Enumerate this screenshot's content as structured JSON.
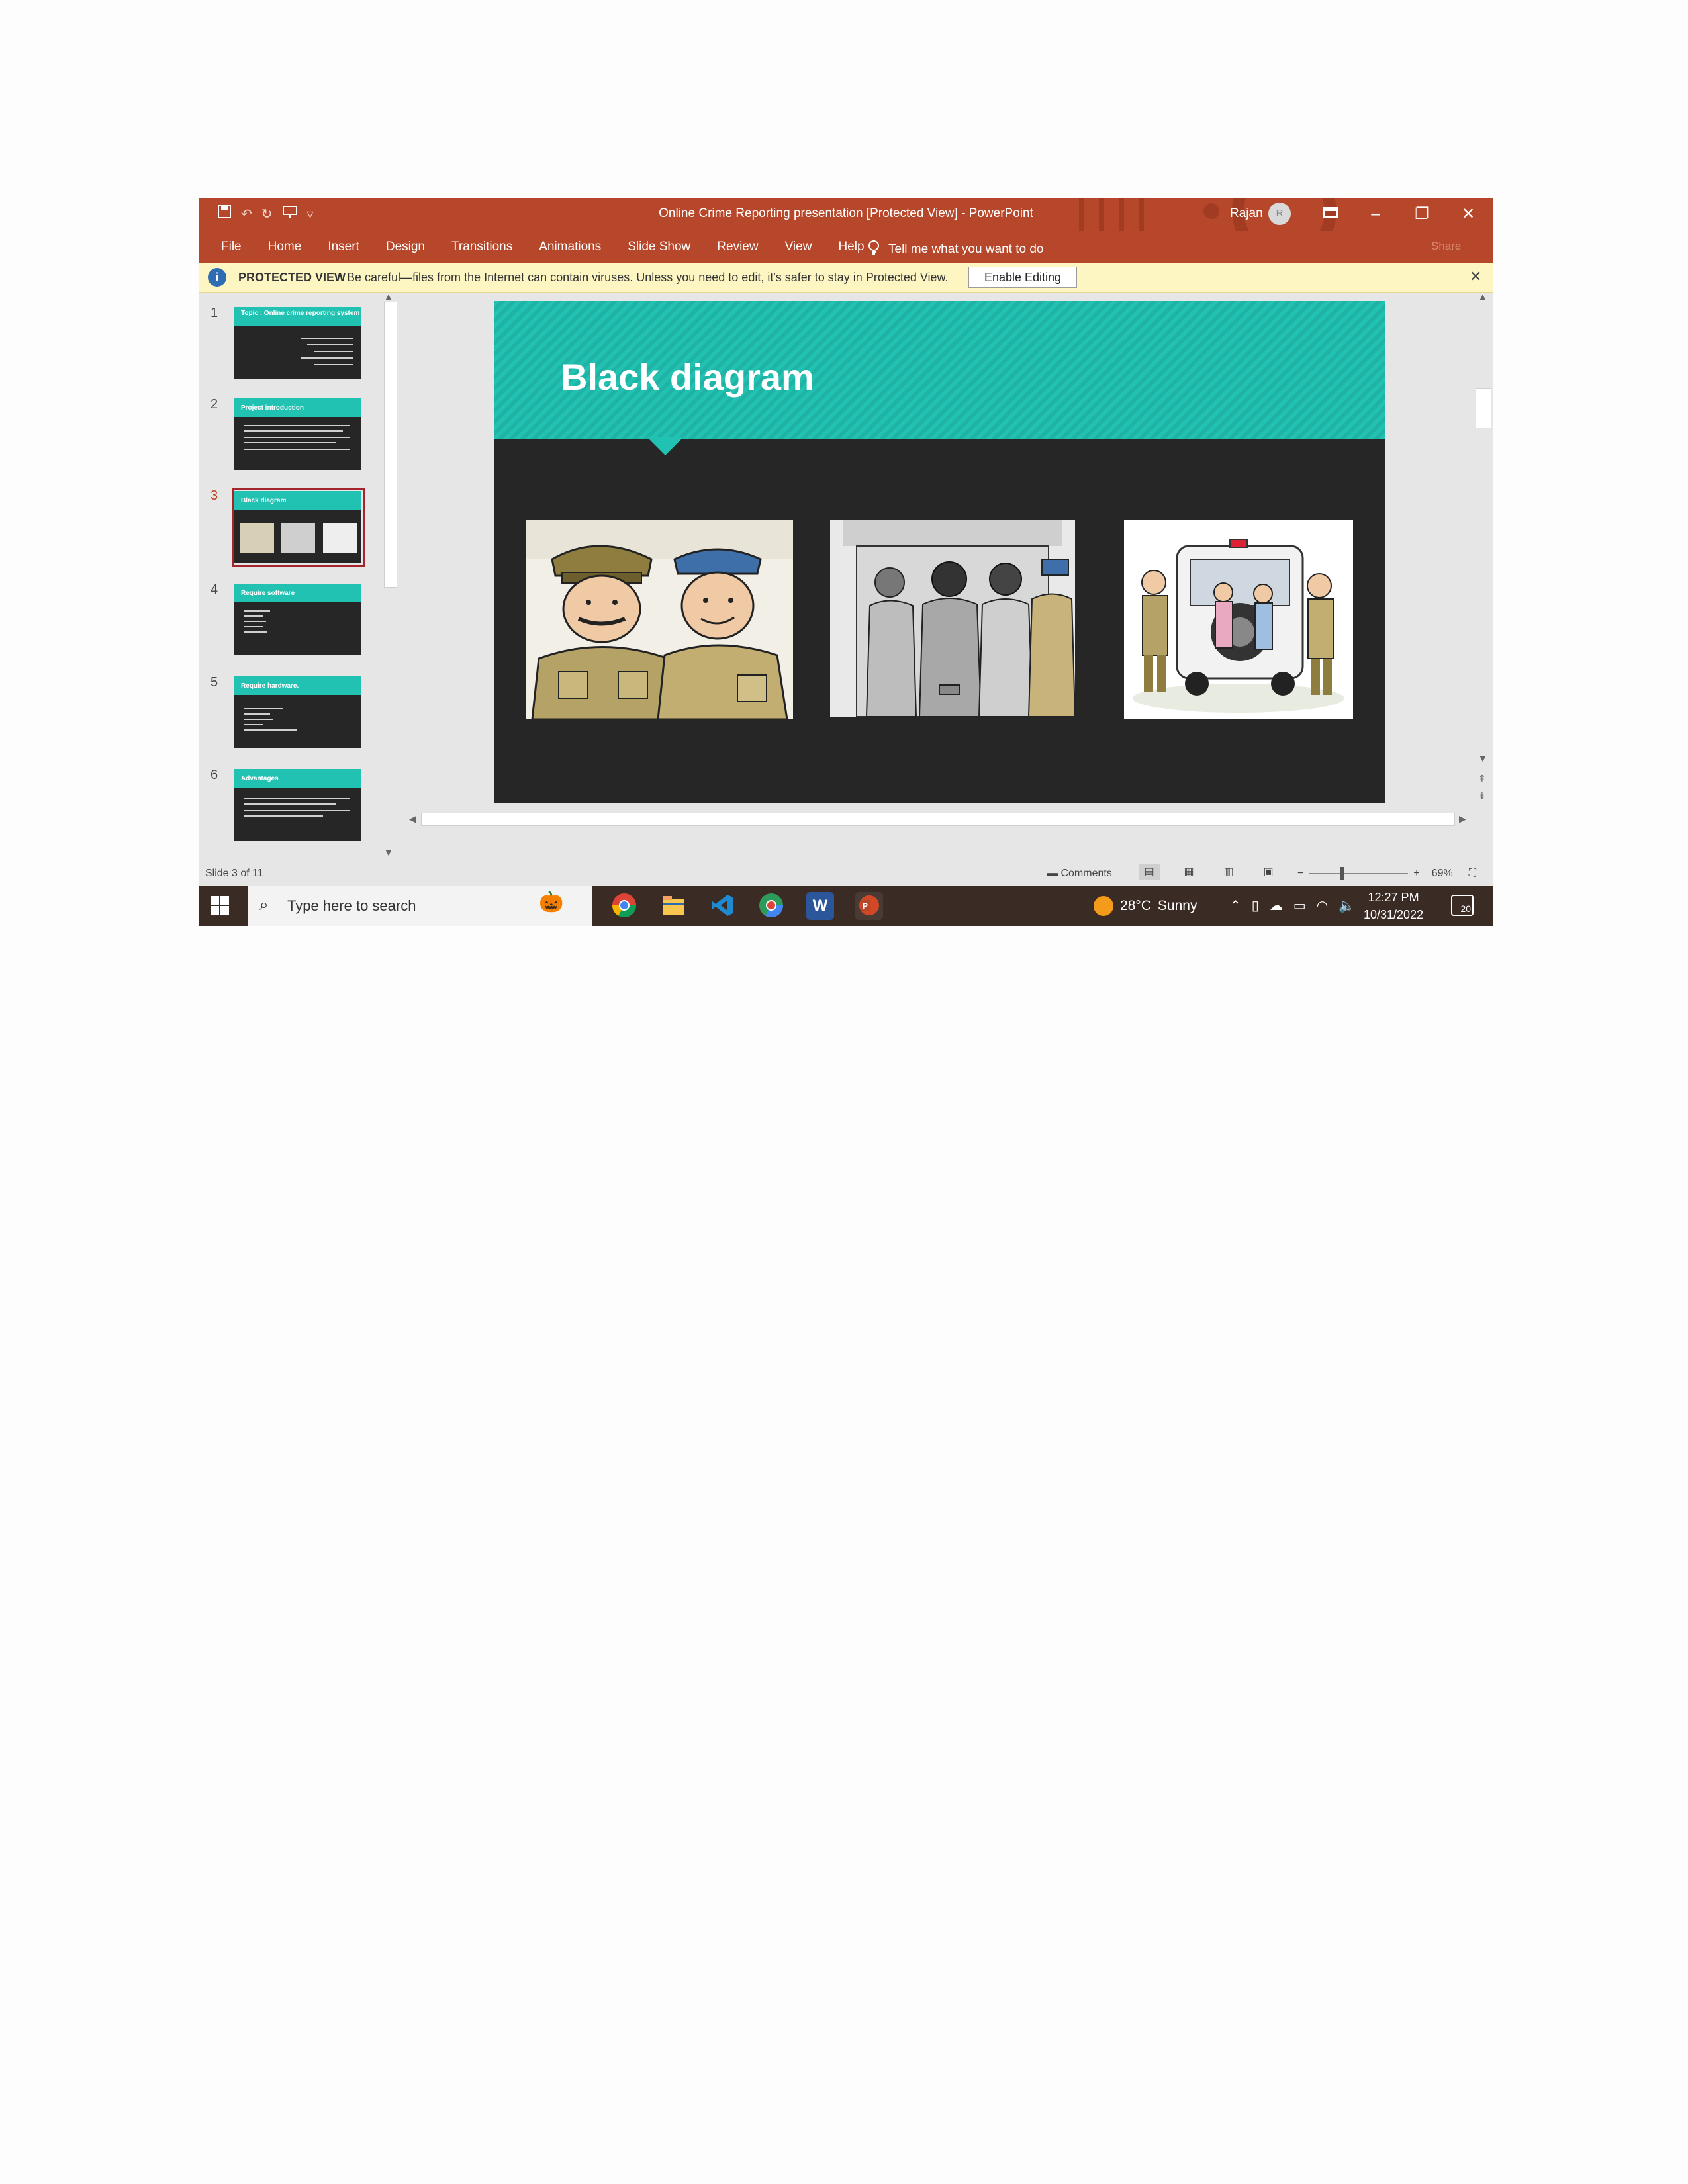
{
  "window": {
    "title": "Online Crime Reporting presentation [Protected View]  -  PowerPoint",
    "user": "Rajan",
    "avatar_initial": "R",
    "qat_icons": [
      "save-icon",
      "undo-icon",
      "redo-icon",
      "present-icon",
      "customize-icon"
    ],
    "controls": [
      "ribbon-display-icon",
      "minimize-icon",
      "restore-icon",
      "close-icon"
    ]
  },
  "ribbon": {
    "tabs": [
      "File",
      "Home",
      "Insert",
      "Design",
      "Transitions",
      "Animations",
      "Slide Show",
      "Review",
      "View",
      "Help"
    ],
    "tell_me": "Tell me what you want to do",
    "share": "Share"
  },
  "protected_view": {
    "label": "PROTECTED VIEW",
    "message": "Be careful—files from the Internet can contain viruses. Unless you need to edit, it's safer to stay in Protected View.",
    "button": "Enable Editing"
  },
  "thumbnails": [
    {
      "number": "1",
      "title": "Topic : Online crime reporting system"
    },
    {
      "number": "2",
      "title": "Project introduction"
    },
    {
      "number": "3",
      "title": "Black diagram",
      "selected": true
    },
    {
      "number": "4",
      "title": "Require software"
    },
    {
      "number": "5",
      "title": "Require hardware."
    },
    {
      "number": "6",
      "title": "Advantages"
    }
  ],
  "slide": {
    "title": "Black diagram",
    "images": [
      "two-police-officers-illustration",
      "handcuffed-suspects-illustration",
      "police-van-arrest-illustration"
    ]
  },
  "status": {
    "slide_info": "Slide 3 of 11",
    "comments": "Comments",
    "zoom": "69%"
  },
  "taskbar": {
    "search_placeholder": "Type here to search",
    "apps": [
      "chrome-icon",
      "file-explorer-icon",
      "vscode-icon",
      "chrome-canary-icon",
      "word-icon",
      "powerpoint-icon"
    ],
    "weather": {
      "temp": "28°C",
      "condition": "Sunny"
    },
    "time": "12:27 PM",
    "date": "10/31/2022",
    "notifications": "20"
  },
  "colors": {
    "accent": "#b7472a",
    "slide_teal": "#22c2b3",
    "slide_dark": "#262626",
    "protected_bg": "#fdf6c3"
  }
}
